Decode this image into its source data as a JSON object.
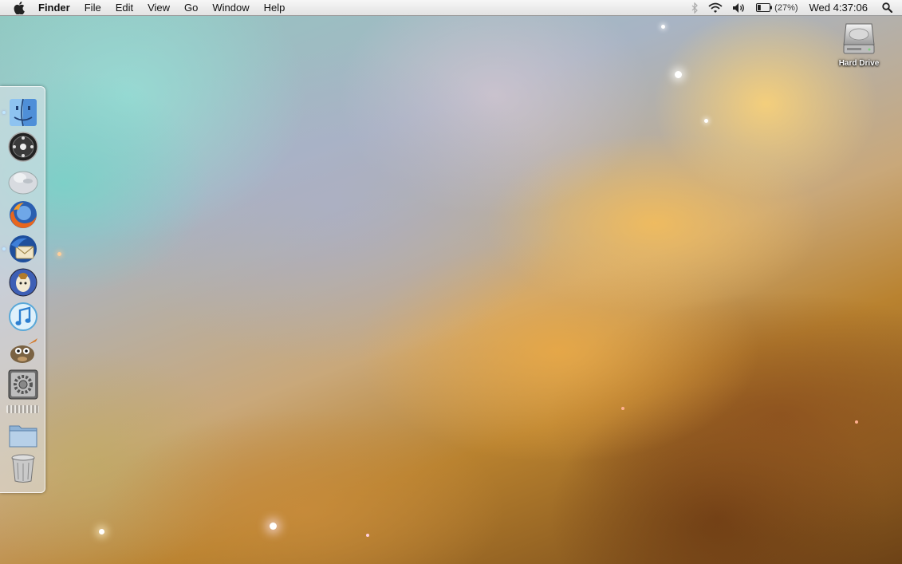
{
  "menubar": {
    "apple_icon": "apple-icon",
    "app_name": "Finder",
    "menus": [
      "File",
      "Edit",
      "View",
      "Go",
      "Window",
      "Help"
    ],
    "status_icons": [
      "bluetooth-icon",
      "wifi-icon",
      "volume-icon",
      "battery-icon",
      "spotlight-icon"
    ],
    "battery_percent": "(27%)",
    "battery_level": 0.27,
    "clock": "Wed 4:37:06"
  },
  "desktop": {
    "icons": [
      {
        "label": "Hard Drive",
        "icon": "hard-drive-icon"
      }
    ]
  },
  "dock": {
    "orientation": "left",
    "items": [
      {
        "app": "Finder",
        "icon": "finder-icon",
        "running": true
      },
      {
        "app": "Camino",
        "icon": "camino-icon",
        "running": false
      },
      {
        "app": "Adium",
        "icon": "adium-duck-icon",
        "running": false
      },
      {
        "app": "Firefox",
        "icon": "firefox-icon",
        "running": false
      },
      {
        "app": "Thunderbird",
        "icon": "thunderbird-icon",
        "running": true
      },
      {
        "app": "Adium",
        "icon": "adium-icon",
        "running": false
      },
      {
        "app": "iTunes",
        "icon": "itunes-icon",
        "running": false
      },
      {
        "app": "GIMP",
        "icon": "gimp-icon",
        "running": false
      },
      {
        "app": "System Preferences",
        "icon": "system-preferences-icon",
        "running": false
      },
      {
        "app": "Documents",
        "icon": "folder-icon",
        "running": false
      },
      {
        "app": "Trash",
        "icon": "trash-icon",
        "running": false
      }
    ]
  }
}
